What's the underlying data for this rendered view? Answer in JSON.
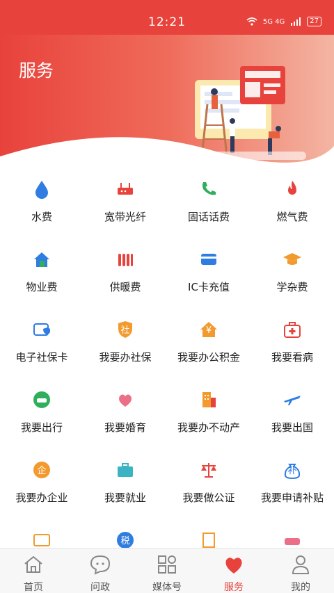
{
  "status": {
    "time": "12:21",
    "network": "5G 4G",
    "battery": "27"
  },
  "header": {
    "title": "服务"
  },
  "services": [
    {
      "label": "水费",
      "icon": "water-drop-icon"
    },
    {
      "label": "宽带光纤",
      "icon": "router-icon"
    },
    {
      "label": "固话话费",
      "icon": "phone-icon"
    },
    {
      "label": "燃气费",
      "icon": "flame-icon"
    },
    {
      "label": "物业费",
      "icon": "house-icon"
    },
    {
      "label": "供暖费",
      "icon": "radiator-icon"
    },
    {
      "label": "IC卡充值",
      "icon": "card-icon"
    },
    {
      "label": "学杂费",
      "icon": "graduation-cap-icon"
    },
    {
      "label": "电子社保卡",
      "icon": "social-security-card-icon"
    },
    {
      "label": "我要办社保",
      "icon": "shield-she-icon",
      "glyph": "社"
    },
    {
      "label": "我要办公积金",
      "icon": "house-yuan-icon",
      "glyph": "¥"
    },
    {
      "label": "我要看病",
      "icon": "medical-kit-icon"
    },
    {
      "label": "我要出行",
      "icon": "car-icon"
    },
    {
      "label": "我要婚育",
      "icon": "heart-family-icon"
    },
    {
      "label": "我要办不动产",
      "icon": "building-icon"
    },
    {
      "label": "我要出国",
      "icon": "airplane-icon"
    },
    {
      "label": "我要办企业",
      "icon": "enterprise-icon",
      "glyph": "企"
    },
    {
      "label": "我要就业",
      "icon": "briefcase-icon"
    },
    {
      "label": "我要做公证",
      "icon": "scale-icon"
    },
    {
      "label": "我要申请补贴",
      "icon": "money-bag-icon",
      "glyph": "补"
    },
    {
      "label": "",
      "icon": "id-card-icon"
    },
    {
      "label": "",
      "icon": "tax-icon",
      "glyph": "税"
    },
    {
      "label": "",
      "icon": "document-icon"
    },
    {
      "label": "",
      "icon": "vehicle-icon"
    }
  ],
  "tabs": [
    {
      "label": "首页",
      "icon": "home-icon",
      "active": false
    },
    {
      "label": "问政",
      "icon": "chat-bubble-icon",
      "active": false
    },
    {
      "label": "媒体号",
      "icon": "grid-icon",
      "active": false
    },
    {
      "label": "服务",
      "icon": "heart-icon",
      "active": true
    },
    {
      "label": "我的",
      "icon": "profile-icon",
      "active": false
    }
  ],
  "colors": {
    "brand": "#e8423c",
    "blue": "#2f7de1",
    "green": "#2fae5c",
    "orange": "#f29a2e",
    "red": "#e8423c"
  }
}
